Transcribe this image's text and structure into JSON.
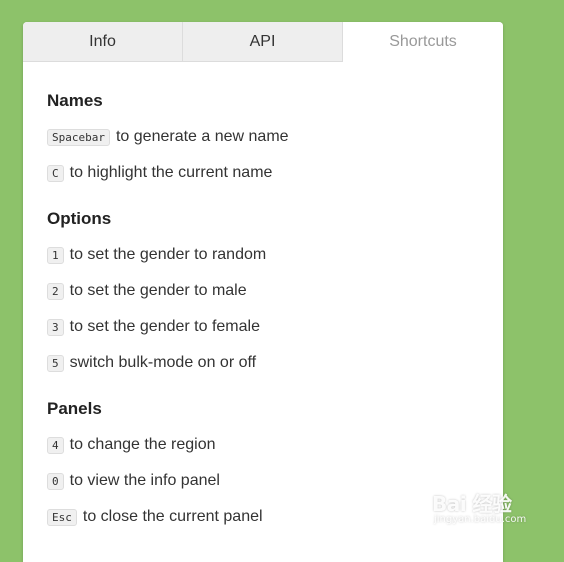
{
  "tabs": [
    {
      "label": "Info"
    },
    {
      "label": "API"
    },
    {
      "label": "Shortcuts"
    }
  ],
  "sections": {
    "names": {
      "title": "Names",
      "items": [
        {
          "key": "Spacebar",
          "text": "to generate a new name"
        },
        {
          "key": "C",
          "text": "to highlight the current name"
        }
      ]
    },
    "options": {
      "title": "Options",
      "items": [
        {
          "key": "1",
          "text": "to set the gender to random"
        },
        {
          "key": "2",
          "text": "to set the gender to male"
        },
        {
          "key": "3",
          "text": "to set the gender to female"
        },
        {
          "key": "5",
          "text": "switch bulk-mode on or off"
        }
      ]
    },
    "panels": {
      "title": "Panels",
      "items": [
        {
          "key": "4",
          "text": "to change the region"
        },
        {
          "key": "0",
          "text": "to view the info panel"
        },
        {
          "key": "Esc",
          "text": "to close the current panel"
        }
      ]
    }
  },
  "watermark": {
    "main": "Bai 经验",
    "sub": "jingyan.baidu.com"
  },
  "colors": {
    "background": "#8dc26a",
    "panel": "#ffffff",
    "tab_inactive": "#eeeeee",
    "tab_active_text": "#999999"
  }
}
